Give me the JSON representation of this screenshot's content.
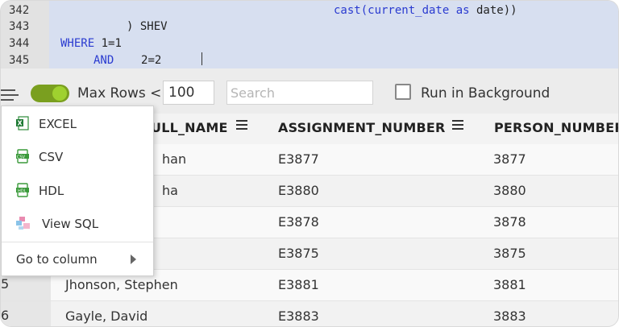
{
  "editor": {
    "lines": [
      {
        "num": "342",
        "text": "cast(current_date as date))"
      },
      {
        "num": "343",
        "text": ") SHEV"
      },
      {
        "num": "344",
        "kw": "WHERE",
        "text": "1=1"
      },
      {
        "num": "345",
        "kw": "AND",
        "text": "2=2"
      }
    ]
  },
  "toolbar": {
    "max_rows_label": "Max Rows <",
    "max_rows_value": "100",
    "search_placeholder": "Search",
    "run_background_label": "Run in Background",
    "toggle_on": true,
    "toggle_color": "#7a9f1f"
  },
  "table": {
    "columns": [
      "ULL_NAME",
      "ASSIGNMENT_NUMBER",
      "PERSON_NUMBER"
    ],
    "rows": [
      {
        "num": "",
        "name": "han",
        "assignment": "E3877",
        "person": "3877"
      },
      {
        "num": "",
        "name": "ha",
        "assignment": "E3880",
        "person": "3880"
      },
      {
        "num": "",
        "name": "",
        "assignment": "E3878",
        "person": "3878"
      },
      {
        "num": "",
        "name": "",
        "assignment": "E3875",
        "person": "3875"
      },
      {
        "num": "5",
        "name": "Jhonson, Stephen",
        "assignment": "E3881",
        "person": "3881"
      },
      {
        "num": "6",
        "name": "Gayle, David",
        "assignment": "E3883",
        "person": "3883"
      }
    ]
  },
  "context_menu": {
    "items": [
      {
        "label": "EXCEL",
        "icon": "excel-icon"
      },
      {
        "label": "CSV",
        "icon": "csv-icon"
      },
      {
        "label": "HDL",
        "icon": "hdl-icon"
      },
      {
        "label": "View SQL",
        "icon": "view-sql-icon"
      }
    ],
    "go_to_column_label": "Go to column"
  }
}
